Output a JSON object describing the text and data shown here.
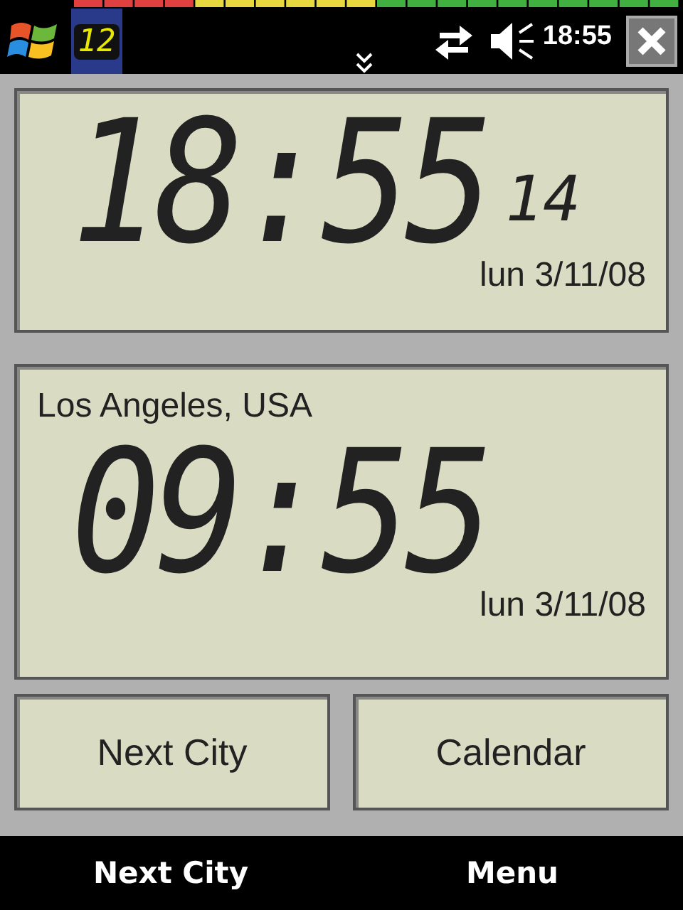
{
  "taskbar": {
    "app_badge": "12",
    "clock": "18:55"
  },
  "local_clock": {
    "time": "18:55",
    "seconds": "14",
    "date": "lun 3/11/08"
  },
  "world_clock": {
    "city": "Los Angeles, USA",
    "time": "09:55",
    "date": "lun 3/11/08"
  },
  "buttons": [
    "Next City",
    "Calendar"
  ],
  "softkeys": {
    "left": "Next City",
    "right": "Menu"
  }
}
